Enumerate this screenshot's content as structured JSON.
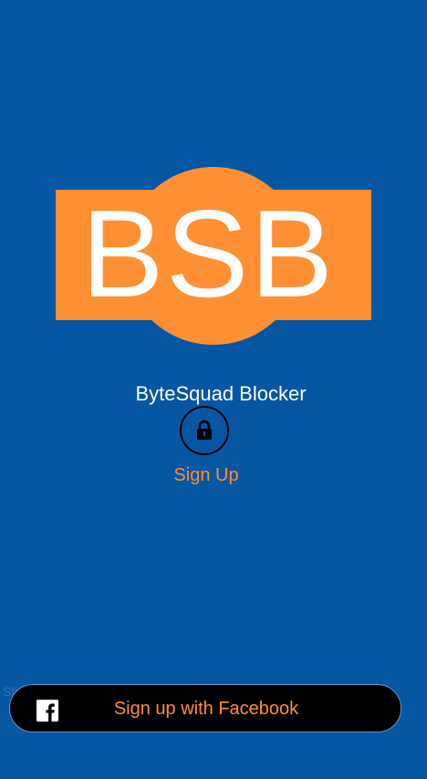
{
  "logo": {
    "text": "BSB",
    "color": "#ff8f33",
    "text_color": "#ffffff"
  },
  "app": {
    "name": "ByteSquad Blocker"
  },
  "auth": {
    "lock_icon": "lock-icon",
    "sign_up_label": "Sign Up",
    "ghost_text": "Sh"
  },
  "social": {
    "facebook_icon": "facebook-icon",
    "facebook_label": "Sign up with Facebook"
  },
  "colors": {
    "background": "#0556a3",
    "accent": "#ff8f33",
    "button_background": "#000000",
    "white": "#ffffff"
  }
}
